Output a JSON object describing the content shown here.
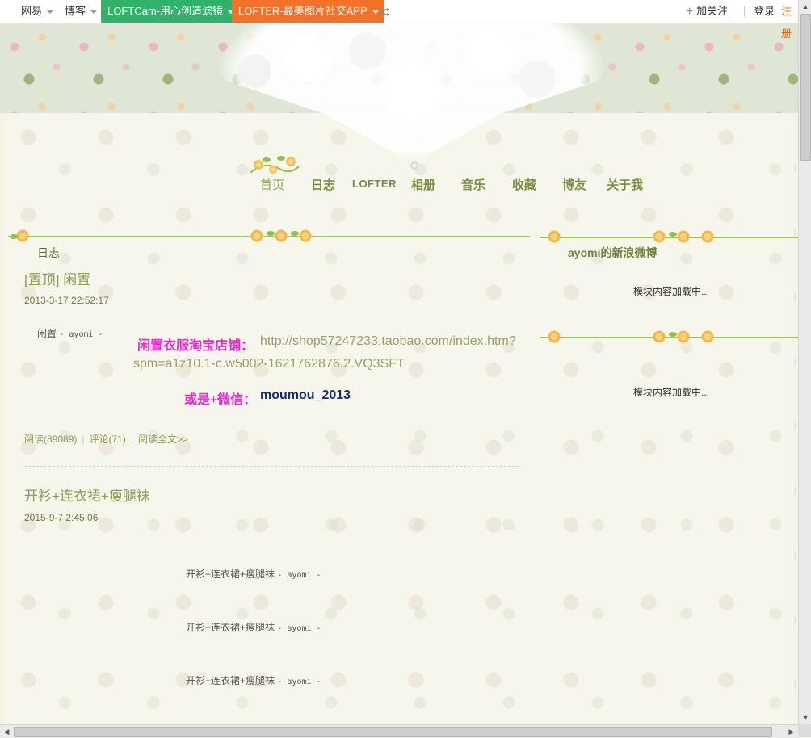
{
  "topbar": {
    "netease": "网易",
    "blog": "博客",
    "loftcam": "LOFTCam-用心创造滤镜",
    "lofter": "LOFTER-最美图片社交APP",
    "follow": "加关注",
    "login": "登录",
    "register": "注册"
  },
  "nav": {
    "items": [
      "首页",
      "日志",
      "LOFTER",
      "相册",
      "音乐",
      "收藏",
      "博友",
      "关于我"
    ]
  },
  "main": {
    "section_title": "日志",
    "posts": [
      {
        "title": "[置顶] 闲置",
        "date": "2013-3-17 22:52:17",
        "caption_a": "闲置",
        "caption_b": "- ayomi -",
        "shop_label": "闲置衣服淘宝店铺：",
        "shop_link_line1": "http://shop57247233.taobao.com/index.htm?",
        "shop_link_line2": "spm=a1z10.1-c.w5002-1621762876.2.VQ3SFT",
        "wechat_label": "或是+微信：",
        "wechat_id": "moumou_2013",
        "reads": "阅读(89089)",
        "comments": "评论(71)",
        "read_more": "阅读全文>>"
      },
      {
        "title": "开衫+连衣裙+瘦腿袜",
        "date": "2015-9-7 2:45:06",
        "captions": [
          {
            "a": "开衫+连衣裙+瘦腿袜",
            "b": "- ayomi -"
          },
          {
            "a": "开衫+连衣裙+瘦腿袜",
            "b": "- ayomi -"
          },
          {
            "a": "开衫+连衣裙+瘦腿袜",
            "b": "- ayomi -"
          }
        ]
      }
    ]
  },
  "sidebar": {
    "weibo_title": "ayomi的新浪微博",
    "loading_1": "模块内容加载中...",
    "loading_2": "模块内容加载中..."
  },
  "colors": {
    "accent_green": "#31b26b",
    "accent_orange": "#f2722a",
    "nav_text": "#7a8f44",
    "highlight_magenta": "#e32ad0",
    "wechat_id": "#11306b"
  }
}
